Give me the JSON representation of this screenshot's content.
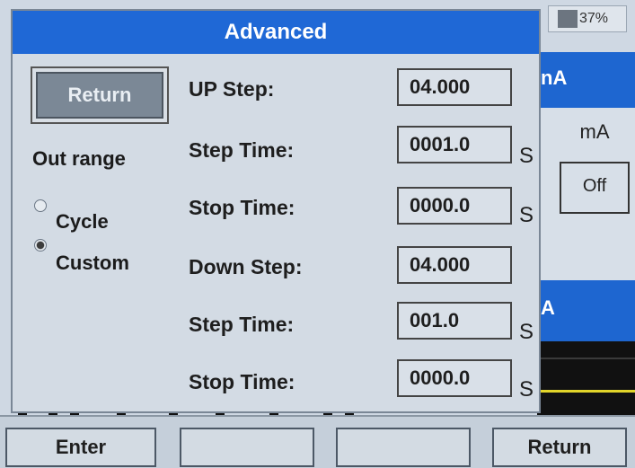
{
  "status": {
    "battery": "37%"
  },
  "background": {
    "unit_banner": "nA",
    "unit": "mA",
    "output_state": "Off",
    "lower_banner": "A"
  },
  "dialog": {
    "title": "Advanced",
    "return_label": "Return",
    "out_range_label": "Out range",
    "options": [
      {
        "label": "Cycle",
        "selected": false
      },
      {
        "label": "Custom",
        "selected": true
      }
    ],
    "rows": [
      {
        "label": "UP Step:",
        "value": "04.000",
        "unit": ""
      },
      {
        "label": "Step Time:",
        "value": "0001.0",
        "unit": "S"
      },
      {
        "label": "Stop Time:",
        "value": "0000.0",
        "unit": "S"
      },
      {
        "label": "Down Step:",
        "value": "04.000",
        "unit": ""
      },
      {
        "label": "Step Time:",
        "value": "001.0",
        "unit": "S"
      },
      {
        "label": "Stop Time:",
        "value": "0000.0",
        "unit": "S"
      }
    ]
  },
  "bottom_bar": {
    "buttons": [
      "Enter",
      "",
      "",
      "Return"
    ]
  }
}
